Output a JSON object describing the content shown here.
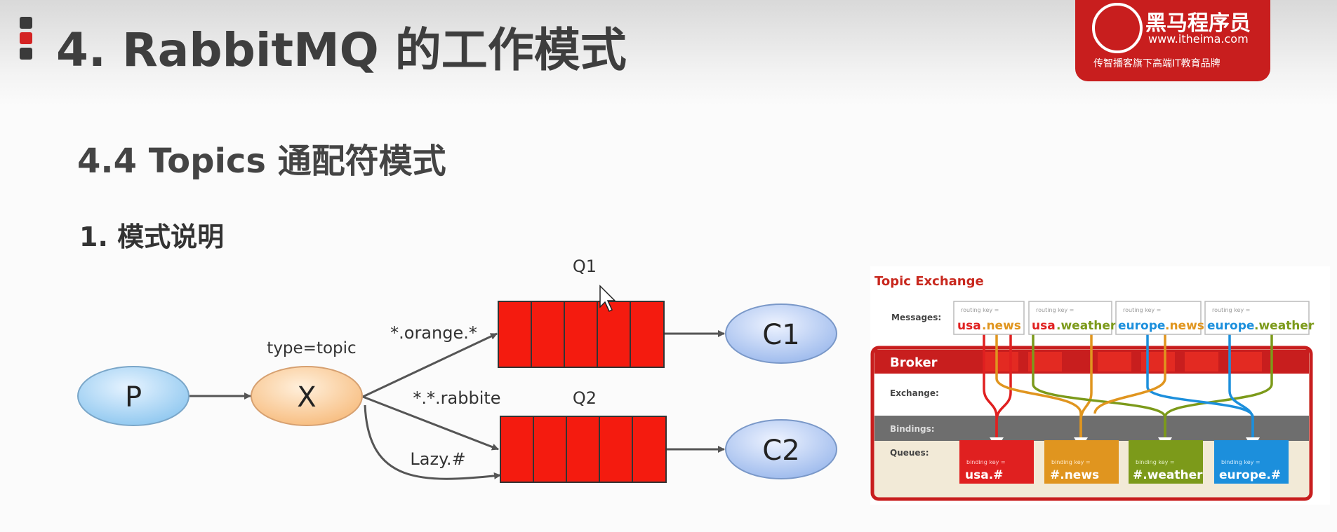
{
  "page_title": "4. RabbitMQ 的工作模式",
  "section_title": "4.4 Topics 通配符模式",
  "subsection_title": "1. 模式说明",
  "logo": {
    "name": "黑马程序员",
    "url": "www.itheima.com",
    "slogan": "传智播客旗下高端IT教育品牌"
  },
  "diagram": {
    "producer": "P",
    "exchange": "X",
    "exchange_type": "type=topic",
    "queue1": "Q1",
    "queue2": "Q2",
    "consumer1": "C1",
    "consumer2": "C2",
    "binding1": "*.orange.*",
    "binding2": "*.*.rabbite",
    "binding3": "Lazy.#"
  },
  "topic_exchange": {
    "title": "Topic Exchange",
    "messages_label": "Messages:",
    "broker_label": "Broker",
    "exchange_label": "Exchange:",
    "bindings_label": "Bindings:",
    "queues_label": "Queues:",
    "messages": [
      {
        "prefix": "usa",
        "suffix": ".news",
        "key_label": "routing key ="
      },
      {
        "prefix": "usa",
        "suffix": ".weather",
        "key_label": "routing key ="
      },
      {
        "prefix": "europe",
        "suffix": ".news",
        "key_label": "routing key ="
      },
      {
        "prefix": "europe",
        "suffix": ".weather",
        "key_label": "routing key ="
      }
    ],
    "queues": [
      {
        "text": "usa.#",
        "key_label": "binding key =",
        "color": "#e02020"
      },
      {
        "text": "#.news",
        "key_label": "binding key =",
        "color": "#e0951f"
      },
      {
        "text": "#.weather",
        "key_label": "binding key =",
        "color": "#7c9a1a"
      },
      {
        "text": "europe.#",
        "key_label": "binding key =",
        "color": "#1c8fdc"
      }
    ],
    "colors": {
      "usa": "#e02020",
      "europe": "#1c8fdc",
      "news": "#e0951f",
      "weather": "#7c9a1a"
    }
  }
}
